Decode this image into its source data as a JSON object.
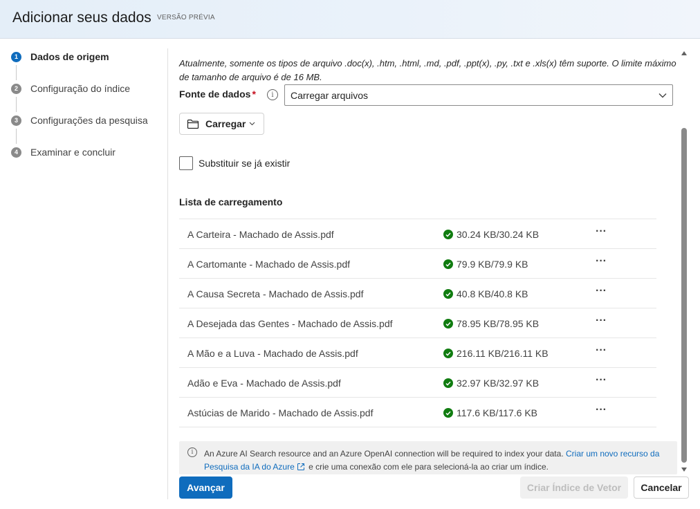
{
  "header": {
    "title": "Adicionar seus dados",
    "preview_badge": "VERSÃO PRÉVIA"
  },
  "steps": [
    {
      "number": "1",
      "label": "Dados de origem",
      "active": true
    },
    {
      "number": "2",
      "label": "Configuração do índice",
      "active": false
    },
    {
      "number": "3",
      "label": "Configurações da pesquisa",
      "active": false
    },
    {
      "number": "4",
      "label": "Examinar e concluir",
      "active": false
    }
  ],
  "main": {
    "info_text": "Atualmente, somente os tipos de arquivo .doc(x), .htm, .html, .md, .pdf, .ppt(x), .py, .txt e .xls(x) têm suporte. O limite máximo de tamanho de arquivo é de 16 MB.",
    "data_source_label": "Fonte de dados",
    "required_mark": "*",
    "data_source_value": "Carregar arquivos",
    "upload_button": "Carregar",
    "overwrite_checkbox_label": "Substituir se já existir",
    "overwrite_checked": false,
    "upload_list_title": "Lista de carregamento",
    "files": [
      {
        "name": "A Carteira - Machado de Assis.pdf",
        "size": "30.24 KB/30.24 KB"
      },
      {
        "name": "A Cartomante - Machado de Assis.pdf",
        "size": "79.9 KB/79.9 KB"
      },
      {
        "name": "A Causa Secreta - Machado de Assis.pdf",
        "size": "40.8 KB/40.8 KB"
      },
      {
        "name": "A Desejada das Gentes - Machado de Assis.pdf",
        "size": "78.95 KB/78.95 KB"
      },
      {
        "name": "A Mão e a Luva - Machado de Assis.pdf",
        "size": "216.11 KB/216.11 KB"
      },
      {
        "name": "Adão e Eva - Machado de Assis.pdf",
        "size": "32.97 KB/32.97 KB"
      },
      {
        "name": "Astúcias de Marido - Machado de Assis.pdf",
        "size": "117.6 KB/117.6 KB"
      }
    ],
    "more_label": "···"
  },
  "notice": {
    "text": "An Azure AI Search resource and an Azure OpenAI connection will be required to index your data.",
    "link": "Criar um novo recurso da Pesquisa da IA do Azure",
    "text_after": "e crie uma conexão com ele para selecioná-la ao criar um índice."
  },
  "footer": {
    "next_button": "Avançar",
    "create_vector_index_button": "Criar Índice de Vetor",
    "cancel_button": "Cancelar"
  },
  "colors": {
    "accent": "#0f6cbd",
    "success": "#107c10",
    "required": "#c50f1f"
  }
}
